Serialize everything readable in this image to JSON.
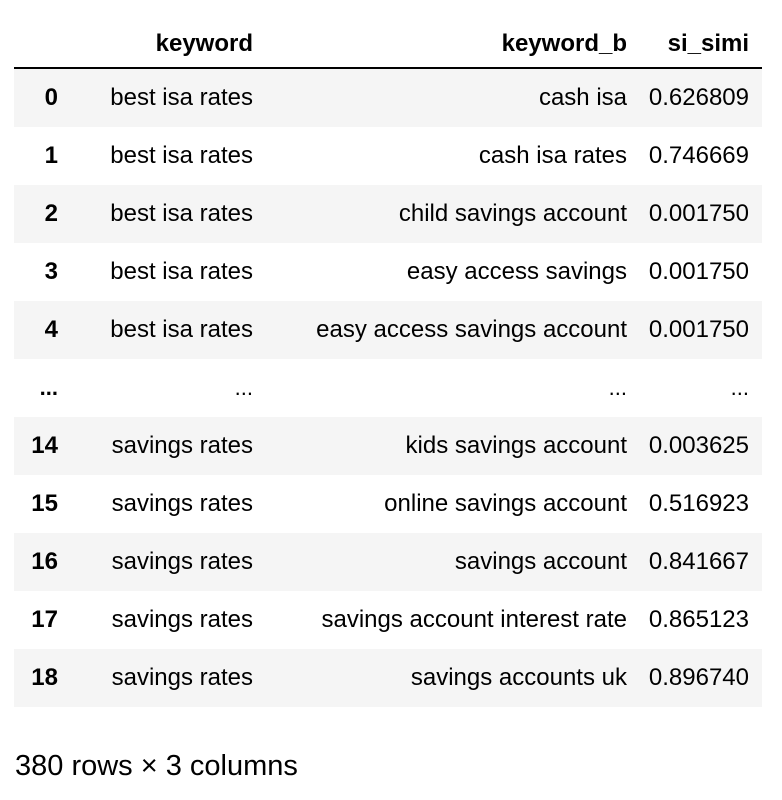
{
  "dataframe": {
    "columns": {
      "index": "",
      "keyword": "keyword",
      "keyword_b": "keyword_b",
      "si_simi": "si_simi"
    },
    "rows": [
      {
        "index": "0",
        "keyword": "best isa rates",
        "keyword_b": "cash isa",
        "si_simi": "0.626809"
      },
      {
        "index": "1",
        "keyword": "best isa rates",
        "keyword_b": "cash isa rates",
        "si_simi": "0.746669"
      },
      {
        "index": "2",
        "keyword": "best isa rates",
        "keyword_b": "child savings account",
        "si_simi": "0.001750"
      },
      {
        "index": "3",
        "keyword": "best isa rates",
        "keyword_b": "easy access savings",
        "si_simi": "0.001750"
      },
      {
        "index": "4",
        "keyword": "best isa rates",
        "keyword_b": "easy access savings account",
        "si_simi": "0.001750"
      },
      {
        "index": "...",
        "keyword": "...",
        "keyword_b": "...",
        "si_simi": "..."
      },
      {
        "index": "14",
        "keyword": "savings rates",
        "keyword_b": "kids savings account",
        "si_simi": "0.003625"
      },
      {
        "index": "15",
        "keyword": "savings rates",
        "keyword_b": "online savings account",
        "si_simi": "0.516923"
      },
      {
        "index": "16",
        "keyword": "savings rates",
        "keyword_b": "savings account",
        "si_simi": "0.841667"
      },
      {
        "index": "17",
        "keyword": "savings rates",
        "keyword_b": "savings account interest rate",
        "si_simi": "0.865123"
      },
      {
        "index": "18",
        "keyword": "savings rates",
        "keyword_b": "savings accounts uk",
        "si_simi": "0.896740"
      }
    ],
    "shape_caption": "380 rows × 3 columns"
  },
  "colors": {
    "stripe": "#f5f5f5",
    "header_border": "#000000",
    "text": "#000000"
  }
}
